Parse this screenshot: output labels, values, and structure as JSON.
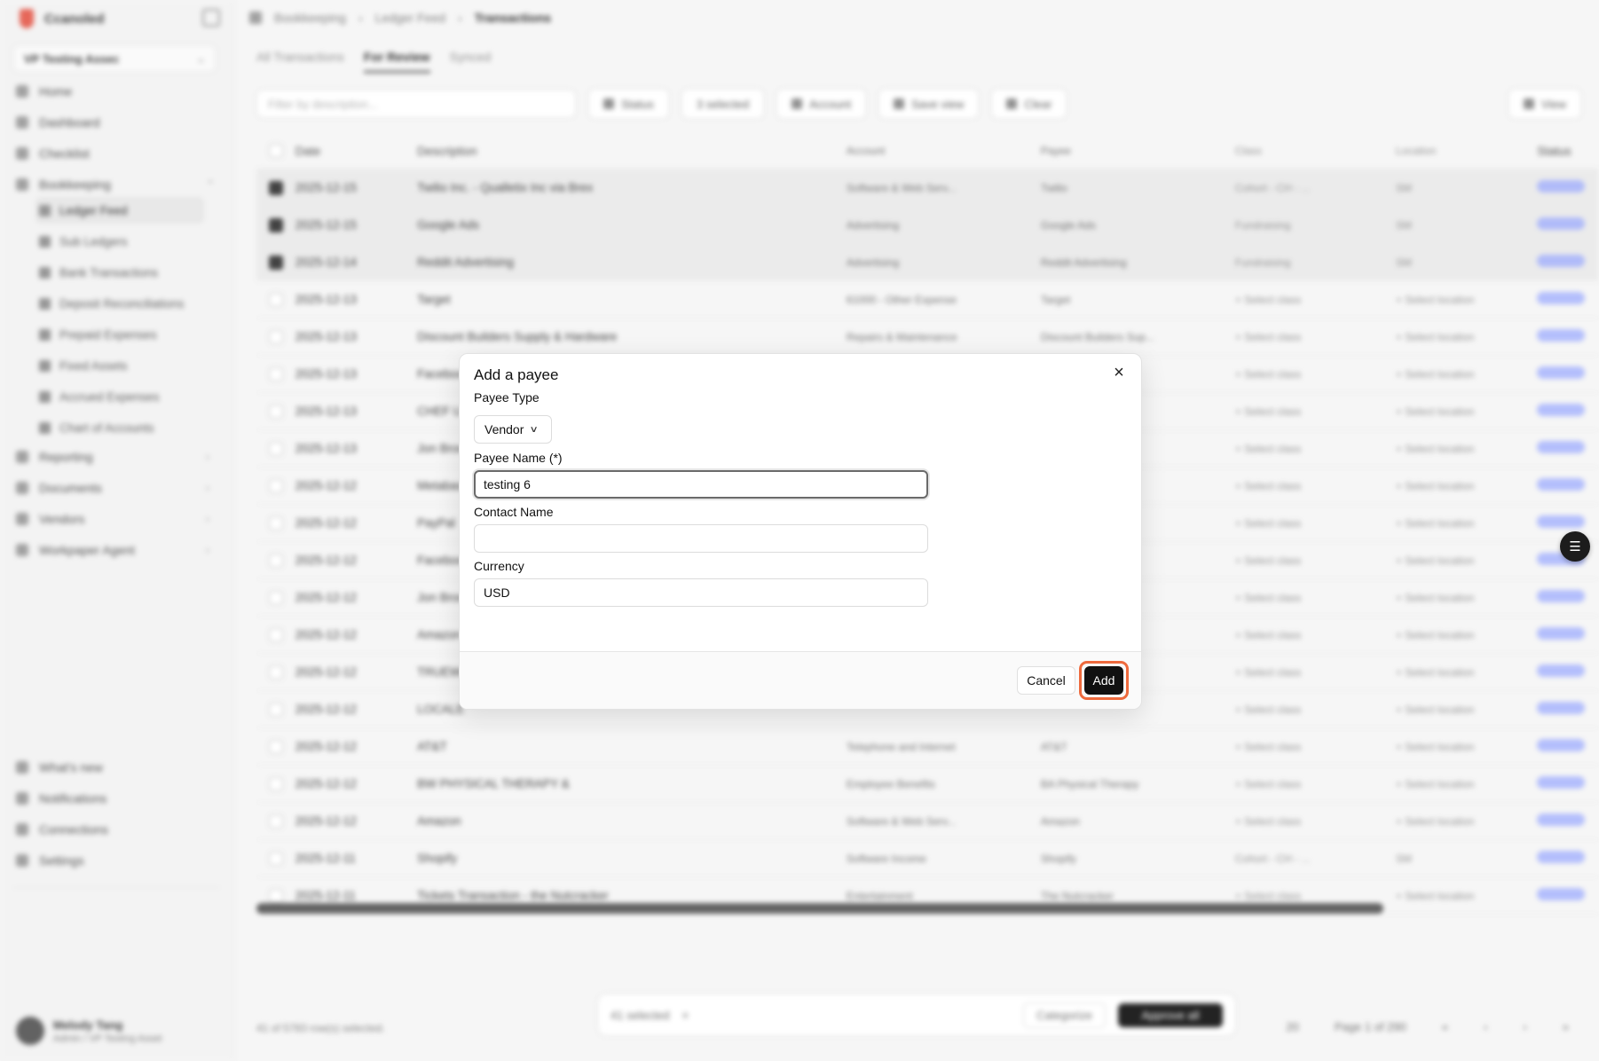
{
  "sidebar": {
    "brand": "Ccanoled",
    "org": "VP Testing Assec",
    "nav": [
      "Home",
      "Dashboard",
      "Checklist",
      "Bookkeeping"
    ],
    "sub": [
      "Ledger Feed",
      "Sub Ledgers",
      "Bank Transactions",
      "Deposit Reconciliations",
      "Prepaid Expenses",
      "Fixed Assets",
      "Accrued Expenses",
      "Chart of Accounts"
    ],
    "nav2": [
      "Reporting",
      "Documents",
      "Vendors",
      "Workpaper Agent"
    ],
    "bottom": [
      "What's new",
      "Notifications",
      "Connections",
      "Settings"
    ],
    "user_name": "Melody Tang",
    "user_role": "Admin / VP Testing Asset"
  },
  "main": {
    "breadcrumb": [
      "Bookkeeping",
      "Ledger Feed",
      "Transactions"
    ],
    "tabs": [
      "All Transactions",
      "For Review",
      "Synced"
    ],
    "filter_placeholder": "Filter by description...",
    "toolbar": [
      "Status",
      "3 selected",
      "Account",
      "Save view",
      "Clear"
    ],
    "view_btn": "View",
    "headers": [
      "Date",
      "Description",
      "Account",
      "Payee",
      "Class",
      "Location",
      "Status"
    ],
    "rows": [
      {
        "date": "2025-12-15",
        "desc": "Twilio Inc. - Qualletix Inc via Brex",
        "acct": "Software & Web Serv...",
        "payee": "Twilio",
        "cls": "Cohort - CH - ...",
        "loc": "SM",
        "sel": true
      },
      {
        "date": "2025-12-15",
        "desc": "Google Ads",
        "acct": "Advertising",
        "payee": "Google Ads",
        "cls": "Fundraising",
        "loc": "SM",
        "sel": true
      },
      {
        "date": "2025-12-14",
        "desc": "Reddit Advertising",
        "acct": "Advertising",
        "payee": "Reddit Advertising",
        "cls": "Fundraising",
        "loc": "SM",
        "sel": true
      },
      {
        "date": "2025-12-13",
        "desc": "Target",
        "acct": "61000 - Other Expense",
        "payee": "Target",
        "cls": "+ Select class",
        "loc": "+ Select location",
        "sel": false
      },
      {
        "date": "2025-12-13",
        "desc": "Discount Builders Supply & Hardware",
        "acct": "Repairs & Maintenance",
        "payee": "Discount Builders Sup...",
        "cls": "+ Select class",
        "loc": "+ Select location",
        "sel": false
      },
      {
        "date": "2025-12-13",
        "desc": "Facebook",
        "acct": "",
        "payee": "",
        "cls": "+ Select class",
        "loc": "+ Select location",
        "sel": false
      },
      {
        "date": "2025-12-13",
        "desc": "CHEF UX",
        "acct": "",
        "payee": "",
        "cls": "+ Select class",
        "loc": "+ Select location",
        "sel": false
      },
      {
        "date": "2025-12-13",
        "desc": "Jon Brow",
        "acct": "",
        "payee": "",
        "cls": "+ Select class",
        "loc": "+ Select location",
        "sel": false
      },
      {
        "date": "2025-12-12",
        "desc": "Metabase",
        "acct": "",
        "payee": "",
        "cls": "+ Select class",
        "loc": "+ Select location",
        "sel": false
      },
      {
        "date": "2025-12-12",
        "desc": "PayPal",
        "acct": "",
        "payee": "",
        "cls": "+ Select class",
        "loc": "+ Select location",
        "sel": false
      },
      {
        "date": "2025-12-12",
        "desc": "Facebook",
        "acct": "",
        "payee": "",
        "cls": "+ Select class",
        "loc": "+ Select location",
        "sel": false
      },
      {
        "date": "2025-12-12",
        "desc": "Jon Brow",
        "acct": "",
        "payee": "",
        "cls": "+ Select class",
        "loc": "+ Select location",
        "sel": false
      },
      {
        "date": "2025-12-12",
        "desc": "Amazon",
        "acct": "",
        "payee": "",
        "cls": "+ Select class",
        "loc": "+ Select location",
        "sel": false
      },
      {
        "date": "2025-12-12",
        "desc": "TRUEWE",
        "acct": "",
        "payee": "",
        "cls": "+ Select class",
        "loc": "+ Select location",
        "sel": false
      },
      {
        "date": "2025-12-12",
        "desc": "LOCALE",
        "acct": "",
        "payee": "",
        "cls": "+ Select class",
        "loc": "+ Select location",
        "sel": false
      },
      {
        "date": "2025-12-12",
        "desc": "AT&T",
        "acct": "Telephone and Internet",
        "payee": "AT&T",
        "cls": "+ Select class",
        "loc": "+ Select location",
        "sel": false
      },
      {
        "date": "2025-12-12",
        "desc": "BW PHYSICAL THERAPY &",
        "acct": "Employee Benefits",
        "payee": "BA Physical Therapy",
        "cls": "+ Select class",
        "loc": "+ Select location",
        "sel": false
      },
      {
        "date": "2025-12-12",
        "desc": "Amazon",
        "acct": "Software & Web Serv...",
        "payee": "Amazon",
        "cls": "+ Select class",
        "loc": "+ Select location",
        "sel": false
      },
      {
        "date": "2025-12-11",
        "desc": "Shopify",
        "acct": "Software Income",
        "payee": "Shopify",
        "cls": "Cohort - CH - ...",
        "loc": "SM",
        "sel": false
      },
      {
        "date": "2025-12-11",
        "desc": "Tickets Transaction - the Nutcracker",
        "acct": "Entertainment",
        "payee": "The Nutcracker",
        "cls": "+ Select class",
        "loc": "+ Select location",
        "sel": false
      }
    ],
    "footer_left": "41 of 5783 row(s) selected.",
    "bulk_selected": "41 selected",
    "bulk_categorize": "Categorize",
    "bulk_approve": "Approve all",
    "pager_rows": "20",
    "pager_page": "Page 1 of 290"
  },
  "modal": {
    "title": "Add a payee",
    "payee_type_label": "Payee Type",
    "payee_type_value": "Vendor",
    "payee_name_label": "Payee Name (*)",
    "payee_name_value": "testing 6",
    "contact_name_label": "Contact Name",
    "contact_name_value": "",
    "currency_label": "Currency",
    "currency_value": "USD",
    "cancel_label": "Cancel",
    "add_label": "Add",
    "close_symbol": "×",
    "highlight_color": "#ee6a3d"
  }
}
